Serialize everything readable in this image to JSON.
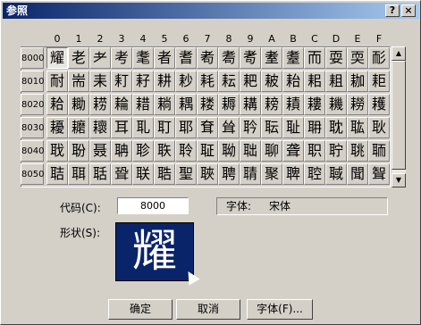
{
  "window": {
    "title": "参照"
  },
  "titlebar_buttons": {
    "help": "?",
    "close": "×"
  },
  "columns": [
    "0",
    "1",
    "2",
    "3",
    "4",
    "5",
    "6",
    "7",
    "8",
    "9",
    "A",
    "B",
    "C",
    "D",
    "E",
    "F"
  ],
  "rows": [
    {
      "code": "8000",
      "chars": [
        "耀",
        "老",
        "耂",
        "考",
        "耄",
        "者",
        "耆",
        "耇",
        "耈",
        "耉",
        "耊",
        "耋",
        "而",
        "耍",
        "耎",
        "耏"
      ]
    },
    {
      "code": "8010",
      "chars": [
        "耐",
        "耑",
        "耒",
        "耓",
        "耔",
        "耕",
        "耖",
        "耗",
        "耘",
        "耙",
        "耚",
        "耛",
        "耜",
        "耝",
        "耞",
        "耟"
      ]
    },
    {
      "code": "8020",
      "chars": [
        "耠",
        "耡",
        "耢",
        "耣",
        "耤",
        "耥",
        "耦",
        "耧",
        "耨",
        "耩",
        "耪",
        "耫",
        "耬",
        "耭",
        "耮",
        "耯"
      ]
    },
    {
      "code": "8030",
      "chars": [
        "耰",
        "耱",
        "耲",
        "耳",
        "耴",
        "耵",
        "耶",
        "耷",
        "耸",
        "耹",
        "耺",
        "耻",
        "耼",
        "耽",
        "耾",
        "耿"
      ]
    },
    {
      "code": "8040",
      "chars": [
        "聀",
        "聁",
        "聂",
        "聃",
        "聄",
        "聅",
        "聆",
        "聇",
        "聈",
        "聉",
        "聊",
        "聋",
        "职",
        "聍",
        "聎",
        "聏"
      ]
    },
    {
      "code": "8050",
      "chars": [
        "聐",
        "聑",
        "聒",
        "聓",
        "联",
        "聕",
        "聖",
        "聗",
        "聘",
        "聙",
        "聚",
        "聛",
        "聜",
        "聝",
        "聞",
        "聟"
      ]
    }
  ],
  "code_label": "代码(C):",
  "code_value": "8000",
  "font_label": "字体:",
  "font_value": "宋体",
  "shape_label": "形状(S):",
  "preview_char": "耀",
  "buttons": {
    "ok": "确定",
    "cancel": "取消",
    "font": "字体(F)..."
  },
  "scrollbar": {
    "up": "▲",
    "down": "▼"
  }
}
